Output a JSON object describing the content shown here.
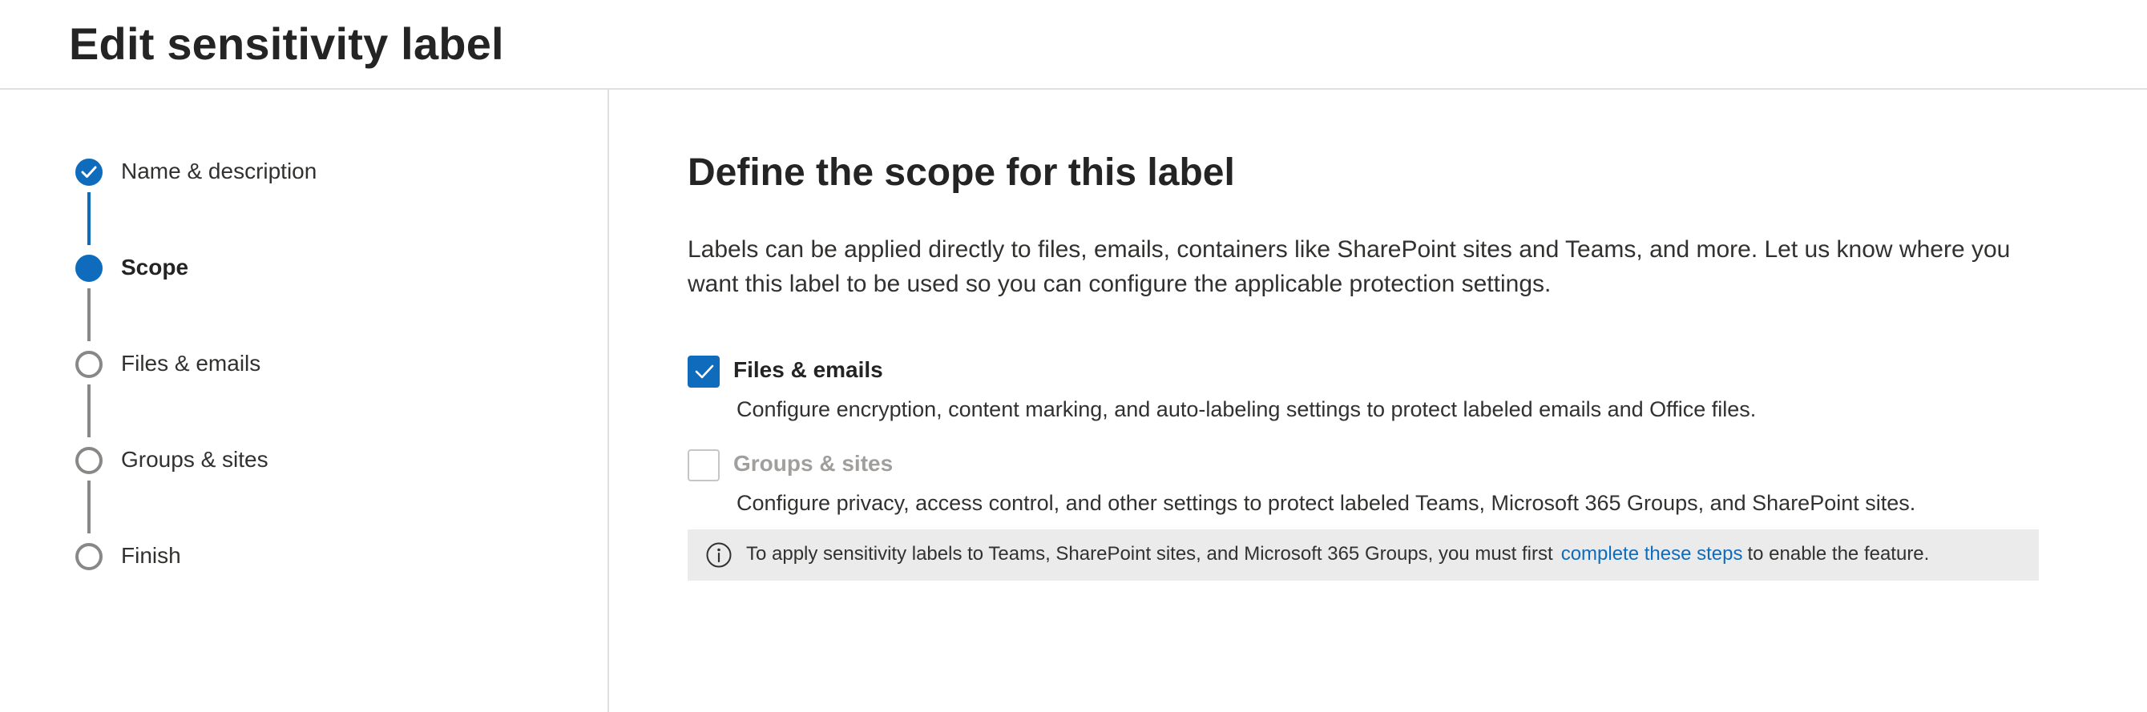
{
  "header": {
    "title": "Edit sensitivity label"
  },
  "wizard": {
    "steps": [
      {
        "label": "Name & description",
        "state": "completed"
      },
      {
        "label": "Scope",
        "state": "current"
      },
      {
        "label": "Files & emails",
        "state": "pending"
      },
      {
        "label": "Groups & sites",
        "state": "pending"
      },
      {
        "label": "Finish",
        "state": "pending"
      }
    ]
  },
  "main": {
    "title": "Define the scope for this label",
    "description": "Labels can be applied directly to files, emails, containers like SharePoint sites and Teams, and more. Let us know where you want this label to be used so you can configure the applicable protection settings.",
    "options": [
      {
        "label": "Files & emails",
        "checked": true,
        "disabled": false,
        "description": "Configure encryption, content marking, and auto-labeling settings to protect labeled emails and Office files."
      },
      {
        "label": "Groups & sites",
        "checked": false,
        "disabled": true,
        "description": "Configure privacy, access control, and other settings to protect labeled Teams, Microsoft 365 Groups, and SharePoint sites."
      }
    ],
    "info": {
      "icon": "info-icon",
      "text_before": "To apply sensitivity labels to Teams, SharePoint sites, and Microsoft 365 Groups, you must first",
      "link_text": "complete these steps",
      "text_after": "to enable the feature."
    }
  },
  "colors": {
    "accent": "#0f6cbd",
    "pending_step": "#8a8886",
    "info_background": "#ebebeb",
    "divider": "#e1dfdd"
  }
}
